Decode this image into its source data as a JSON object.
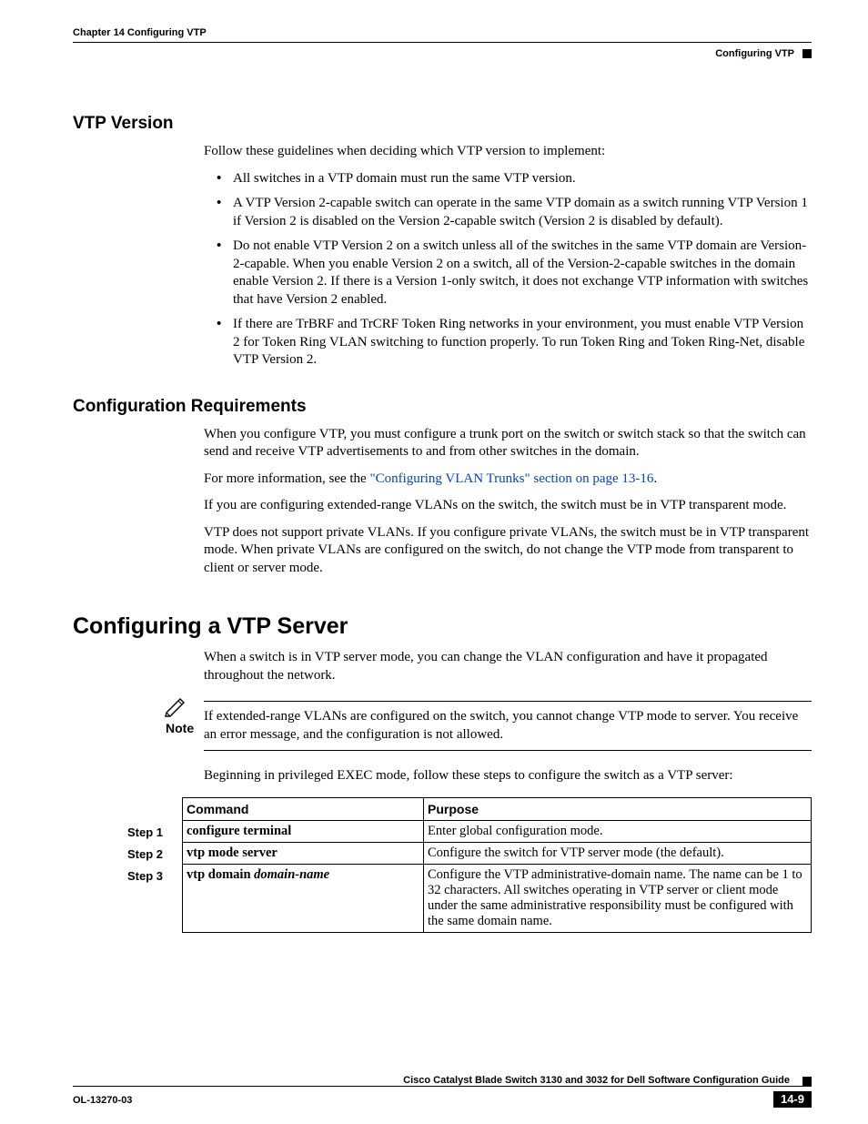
{
  "header": {
    "chapter_left": "Chapter 14    Configuring VTP",
    "section_right": "Configuring VTP"
  },
  "sections": {
    "vtp_version": {
      "title": "VTP Version",
      "intro": "Follow these guidelines when deciding which VTP version to implement:",
      "bullets": [
        "All switches in a VTP domain must run the same VTP version.",
        "A VTP Version 2-capable switch can operate in the same VTP domain as a switch running VTP Version 1 if Version 2 is disabled on the Version 2-capable switch (Version 2 is disabled by default).",
        "Do not enable VTP Version 2 on a switch unless all of the switches in the same VTP domain are Version-2-capable. When you enable Version 2 on a switch, all of the Version-2-capable switches in the domain enable Version 2. If there is a Version 1-only switch, it does not exchange VTP information with switches that have Version 2 enabled.",
        "If there are TrBRF and TrCRF Token Ring networks in your environment, you must enable VTP Version 2 for Token Ring VLAN switching to function properly. To run Token Ring and Token Ring-Net, disable VTP Version 2."
      ]
    },
    "config_req": {
      "title": "Configuration Requirements",
      "p1": "When you configure VTP, you must configure a trunk port on the switch or switch stack so that the switch can send and receive VTP advertisements to and from other switches in the domain.",
      "p2_pre": "For more information, see the ",
      "p2_link": "\"Configuring VLAN Trunks\" section on page 13-16",
      "p2_post": ".",
      "p3": "If you are configuring extended-range VLANs on the switch, the switch must be in VTP transparent mode.",
      "p4": "VTP does not support private VLANs. If you configure private VLANs, the switch must be in VTP transparent mode. When private VLANs are configured on the switch, do not change the VTP mode from transparent to client or server mode."
    },
    "config_server": {
      "title": "Configuring a VTP Server",
      "p1": "When a switch is in VTP server mode, you can change the VLAN configuration and have it propagated throughout the network.",
      "note_label": "Note",
      "note_text": "If extended-range VLANs are configured on the switch, you cannot change VTP mode to server. You receive an error message, and the configuration is not allowed.",
      "p2": "Beginning in privileged EXEC mode, follow these steps to configure the switch as a VTP server:"
    }
  },
  "table": {
    "headers": {
      "command": "Command",
      "purpose": "Purpose"
    },
    "rows": [
      {
        "step": "Step 1",
        "command": "configure terminal",
        "command_italic": "",
        "purpose": "Enter global configuration mode."
      },
      {
        "step": "Step 2",
        "command": "vtp mode server",
        "command_italic": "",
        "purpose": "Configure the switch for VTP server mode (the default)."
      },
      {
        "step": "Step 3",
        "command": "vtp domain ",
        "command_italic": "domain-name",
        "purpose": "Configure the VTP administrative-domain name. The name can be 1 to 32 characters. All switches operating in VTP server or client mode under the same administrative responsibility must be configured with the same domain name."
      }
    ]
  },
  "footer": {
    "guide": "Cisco Catalyst Blade Switch 3130 and 3032 for Dell Software Configuration Guide",
    "doc": "OL-13270-03",
    "pagenum": "14-9"
  }
}
